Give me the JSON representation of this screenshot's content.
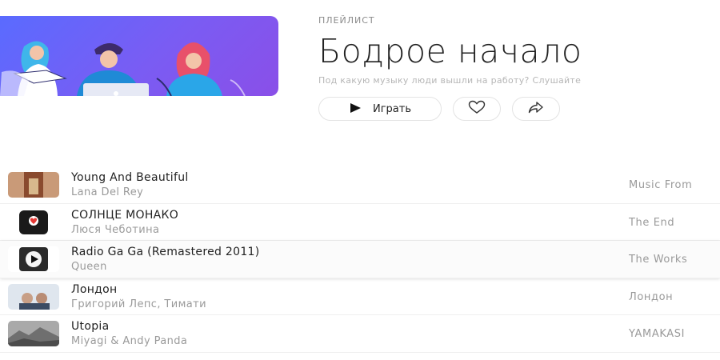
{
  "playlist": {
    "eyebrow": "ПЛЕЙЛИСТ",
    "title": "Бодрое начало",
    "description": "Под какую музыку люди вышли на работу? Слушайте",
    "play_label": "Играть",
    "cover_gradient": [
      "#5a6bff",
      "#8a4fe8"
    ]
  },
  "icons": {
    "play": "play-icon",
    "like": "heart-icon",
    "share": "share-icon"
  },
  "tracks": [
    {
      "title": "Young And Beautiful",
      "artist": "Lana Del Rey",
      "album": "Music From"
    },
    {
      "title": "СОЛНЦЕ МОНАКО",
      "artist": "Люся Чеботина",
      "album": "The End"
    },
    {
      "title": "Radio Ga Ga (Remastered 2011)",
      "artist": "Queen",
      "album": "The Works"
    },
    {
      "title": "Лондон",
      "artist": "Григорий Лепс, Тимати",
      "album": "Лондон"
    },
    {
      "title": "Utopia",
      "artist": "Miyagi & Andy Panda",
      "album": "YAMAKASI"
    }
  ]
}
